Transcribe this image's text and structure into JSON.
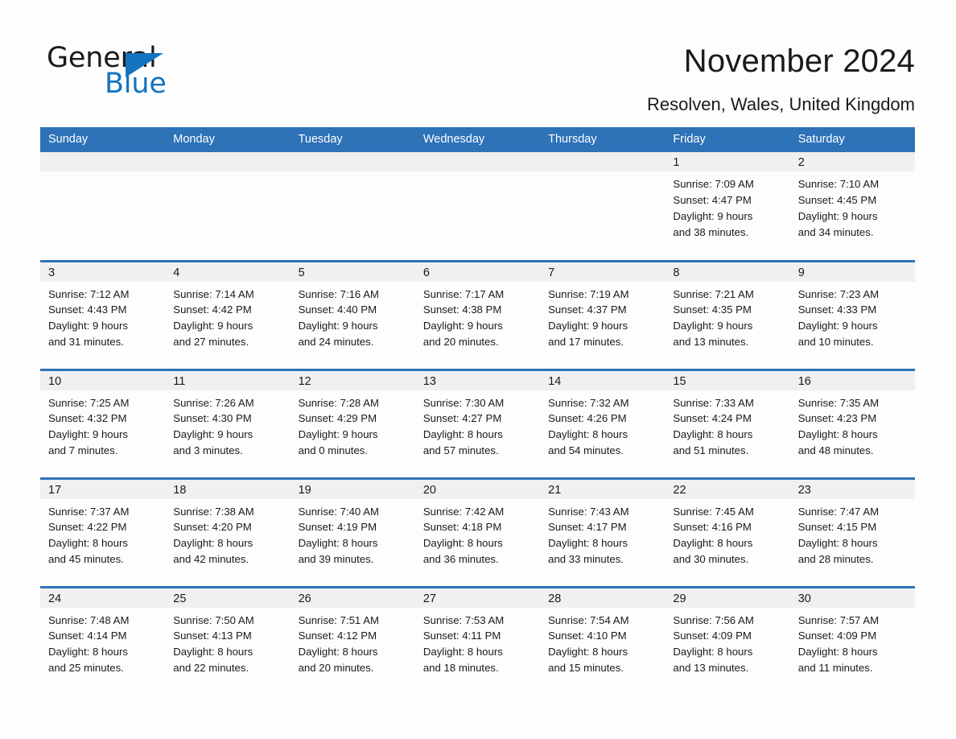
{
  "brand": {
    "name_part1": "General",
    "name_part2": "Blue",
    "accent_color": "#1574bf",
    "triangle_icon": "triangle-icon"
  },
  "header": {
    "month_title": "November 2024",
    "location": "Resolven, Wales, United Kingdom"
  },
  "theme": {
    "header_blue": "#2e72b8",
    "daynum_band_gray": "#f0f0f0",
    "page_background": "#fdfdfd",
    "text_color": "#1a1a1a"
  },
  "calendar": {
    "weekday_headers": [
      "Sunday",
      "Monday",
      "Tuesday",
      "Wednesday",
      "Thursday",
      "Friday",
      "Saturday"
    ],
    "weeks": [
      [
        {
          "day": "",
          "blank": true,
          "sunrise": "",
          "sunset": "",
          "daylight_line1": "",
          "daylight_line2": ""
        },
        {
          "day": "",
          "blank": true,
          "sunrise": "",
          "sunset": "",
          "daylight_line1": "",
          "daylight_line2": ""
        },
        {
          "day": "",
          "blank": true,
          "sunrise": "",
          "sunset": "",
          "daylight_line1": "",
          "daylight_line2": ""
        },
        {
          "day": "",
          "blank": true,
          "sunrise": "",
          "sunset": "",
          "daylight_line1": "",
          "daylight_line2": ""
        },
        {
          "day": "",
          "blank": true,
          "sunrise": "",
          "sunset": "",
          "daylight_line1": "",
          "daylight_line2": ""
        },
        {
          "day": "1",
          "blank": false,
          "sunrise": "Sunrise: 7:09 AM",
          "sunset": "Sunset: 4:47 PM",
          "daylight_line1": "Daylight: 9 hours",
          "daylight_line2": "and 38 minutes."
        },
        {
          "day": "2",
          "blank": false,
          "sunrise": "Sunrise: 7:10 AM",
          "sunset": "Sunset: 4:45 PM",
          "daylight_line1": "Daylight: 9 hours",
          "daylight_line2": "and 34 minutes."
        }
      ],
      [
        {
          "day": "3",
          "blank": false,
          "sunrise": "Sunrise: 7:12 AM",
          "sunset": "Sunset: 4:43 PM",
          "daylight_line1": "Daylight: 9 hours",
          "daylight_line2": "and 31 minutes."
        },
        {
          "day": "4",
          "blank": false,
          "sunrise": "Sunrise: 7:14 AM",
          "sunset": "Sunset: 4:42 PM",
          "daylight_line1": "Daylight: 9 hours",
          "daylight_line2": "and 27 minutes."
        },
        {
          "day": "5",
          "blank": false,
          "sunrise": "Sunrise: 7:16 AM",
          "sunset": "Sunset: 4:40 PM",
          "daylight_line1": "Daylight: 9 hours",
          "daylight_line2": "and 24 minutes."
        },
        {
          "day": "6",
          "blank": false,
          "sunrise": "Sunrise: 7:17 AM",
          "sunset": "Sunset: 4:38 PM",
          "daylight_line1": "Daylight: 9 hours",
          "daylight_line2": "and 20 minutes."
        },
        {
          "day": "7",
          "blank": false,
          "sunrise": "Sunrise: 7:19 AM",
          "sunset": "Sunset: 4:37 PM",
          "daylight_line1": "Daylight: 9 hours",
          "daylight_line2": "and 17 minutes."
        },
        {
          "day": "8",
          "blank": false,
          "sunrise": "Sunrise: 7:21 AM",
          "sunset": "Sunset: 4:35 PM",
          "daylight_line1": "Daylight: 9 hours",
          "daylight_line2": "and 13 minutes."
        },
        {
          "day": "9",
          "blank": false,
          "sunrise": "Sunrise: 7:23 AM",
          "sunset": "Sunset: 4:33 PM",
          "daylight_line1": "Daylight: 9 hours",
          "daylight_line2": "and 10 minutes."
        }
      ],
      [
        {
          "day": "10",
          "blank": false,
          "sunrise": "Sunrise: 7:25 AM",
          "sunset": "Sunset: 4:32 PM",
          "daylight_line1": "Daylight: 9 hours",
          "daylight_line2": "and 7 minutes."
        },
        {
          "day": "11",
          "blank": false,
          "sunrise": "Sunrise: 7:26 AM",
          "sunset": "Sunset: 4:30 PM",
          "daylight_line1": "Daylight: 9 hours",
          "daylight_line2": "and 3 minutes."
        },
        {
          "day": "12",
          "blank": false,
          "sunrise": "Sunrise: 7:28 AM",
          "sunset": "Sunset: 4:29 PM",
          "daylight_line1": "Daylight: 9 hours",
          "daylight_line2": "and 0 minutes."
        },
        {
          "day": "13",
          "blank": false,
          "sunrise": "Sunrise: 7:30 AM",
          "sunset": "Sunset: 4:27 PM",
          "daylight_line1": "Daylight: 8 hours",
          "daylight_line2": "and 57 minutes."
        },
        {
          "day": "14",
          "blank": false,
          "sunrise": "Sunrise: 7:32 AM",
          "sunset": "Sunset: 4:26 PM",
          "daylight_line1": "Daylight: 8 hours",
          "daylight_line2": "and 54 minutes."
        },
        {
          "day": "15",
          "blank": false,
          "sunrise": "Sunrise: 7:33 AM",
          "sunset": "Sunset: 4:24 PM",
          "daylight_line1": "Daylight: 8 hours",
          "daylight_line2": "and 51 minutes."
        },
        {
          "day": "16",
          "blank": false,
          "sunrise": "Sunrise: 7:35 AM",
          "sunset": "Sunset: 4:23 PM",
          "daylight_line1": "Daylight: 8 hours",
          "daylight_line2": "and 48 minutes."
        }
      ],
      [
        {
          "day": "17",
          "blank": false,
          "sunrise": "Sunrise: 7:37 AM",
          "sunset": "Sunset: 4:22 PM",
          "daylight_line1": "Daylight: 8 hours",
          "daylight_line2": "and 45 minutes."
        },
        {
          "day": "18",
          "blank": false,
          "sunrise": "Sunrise: 7:38 AM",
          "sunset": "Sunset: 4:20 PM",
          "daylight_line1": "Daylight: 8 hours",
          "daylight_line2": "and 42 minutes."
        },
        {
          "day": "19",
          "blank": false,
          "sunrise": "Sunrise: 7:40 AM",
          "sunset": "Sunset: 4:19 PM",
          "daylight_line1": "Daylight: 8 hours",
          "daylight_line2": "and 39 minutes."
        },
        {
          "day": "20",
          "blank": false,
          "sunrise": "Sunrise: 7:42 AM",
          "sunset": "Sunset: 4:18 PM",
          "daylight_line1": "Daylight: 8 hours",
          "daylight_line2": "and 36 minutes."
        },
        {
          "day": "21",
          "blank": false,
          "sunrise": "Sunrise: 7:43 AM",
          "sunset": "Sunset: 4:17 PM",
          "daylight_line1": "Daylight: 8 hours",
          "daylight_line2": "and 33 minutes."
        },
        {
          "day": "22",
          "blank": false,
          "sunrise": "Sunrise: 7:45 AM",
          "sunset": "Sunset: 4:16 PM",
          "daylight_line1": "Daylight: 8 hours",
          "daylight_line2": "and 30 minutes."
        },
        {
          "day": "23",
          "blank": false,
          "sunrise": "Sunrise: 7:47 AM",
          "sunset": "Sunset: 4:15 PM",
          "daylight_line1": "Daylight: 8 hours",
          "daylight_line2": "and 28 minutes."
        }
      ],
      [
        {
          "day": "24",
          "blank": false,
          "sunrise": "Sunrise: 7:48 AM",
          "sunset": "Sunset: 4:14 PM",
          "daylight_line1": "Daylight: 8 hours",
          "daylight_line2": "and 25 minutes."
        },
        {
          "day": "25",
          "blank": false,
          "sunrise": "Sunrise: 7:50 AM",
          "sunset": "Sunset: 4:13 PM",
          "daylight_line1": "Daylight: 8 hours",
          "daylight_line2": "and 22 minutes."
        },
        {
          "day": "26",
          "blank": false,
          "sunrise": "Sunrise: 7:51 AM",
          "sunset": "Sunset: 4:12 PM",
          "daylight_line1": "Daylight: 8 hours",
          "daylight_line2": "and 20 minutes."
        },
        {
          "day": "27",
          "blank": false,
          "sunrise": "Sunrise: 7:53 AM",
          "sunset": "Sunset: 4:11 PM",
          "daylight_line1": "Daylight: 8 hours",
          "daylight_line2": "and 18 minutes."
        },
        {
          "day": "28",
          "blank": false,
          "sunrise": "Sunrise: 7:54 AM",
          "sunset": "Sunset: 4:10 PM",
          "daylight_line1": "Daylight: 8 hours",
          "daylight_line2": "and 15 minutes."
        },
        {
          "day": "29",
          "blank": false,
          "sunrise": "Sunrise: 7:56 AM",
          "sunset": "Sunset: 4:09 PM",
          "daylight_line1": "Daylight: 8 hours",
          "daylight_line2": "and 13 minutes."
        },
        {
          "day": "30",
          "blank": false,
          "sunrise": "Sunrise: 7:57 AM",
          "sunset": "Sunset: 4:09 PM",
          "daylight_line1": "Daylight: 8 hours",
          "daylight_line2": "and 11 minutes."
        }
      ]
    ]
  }
}
